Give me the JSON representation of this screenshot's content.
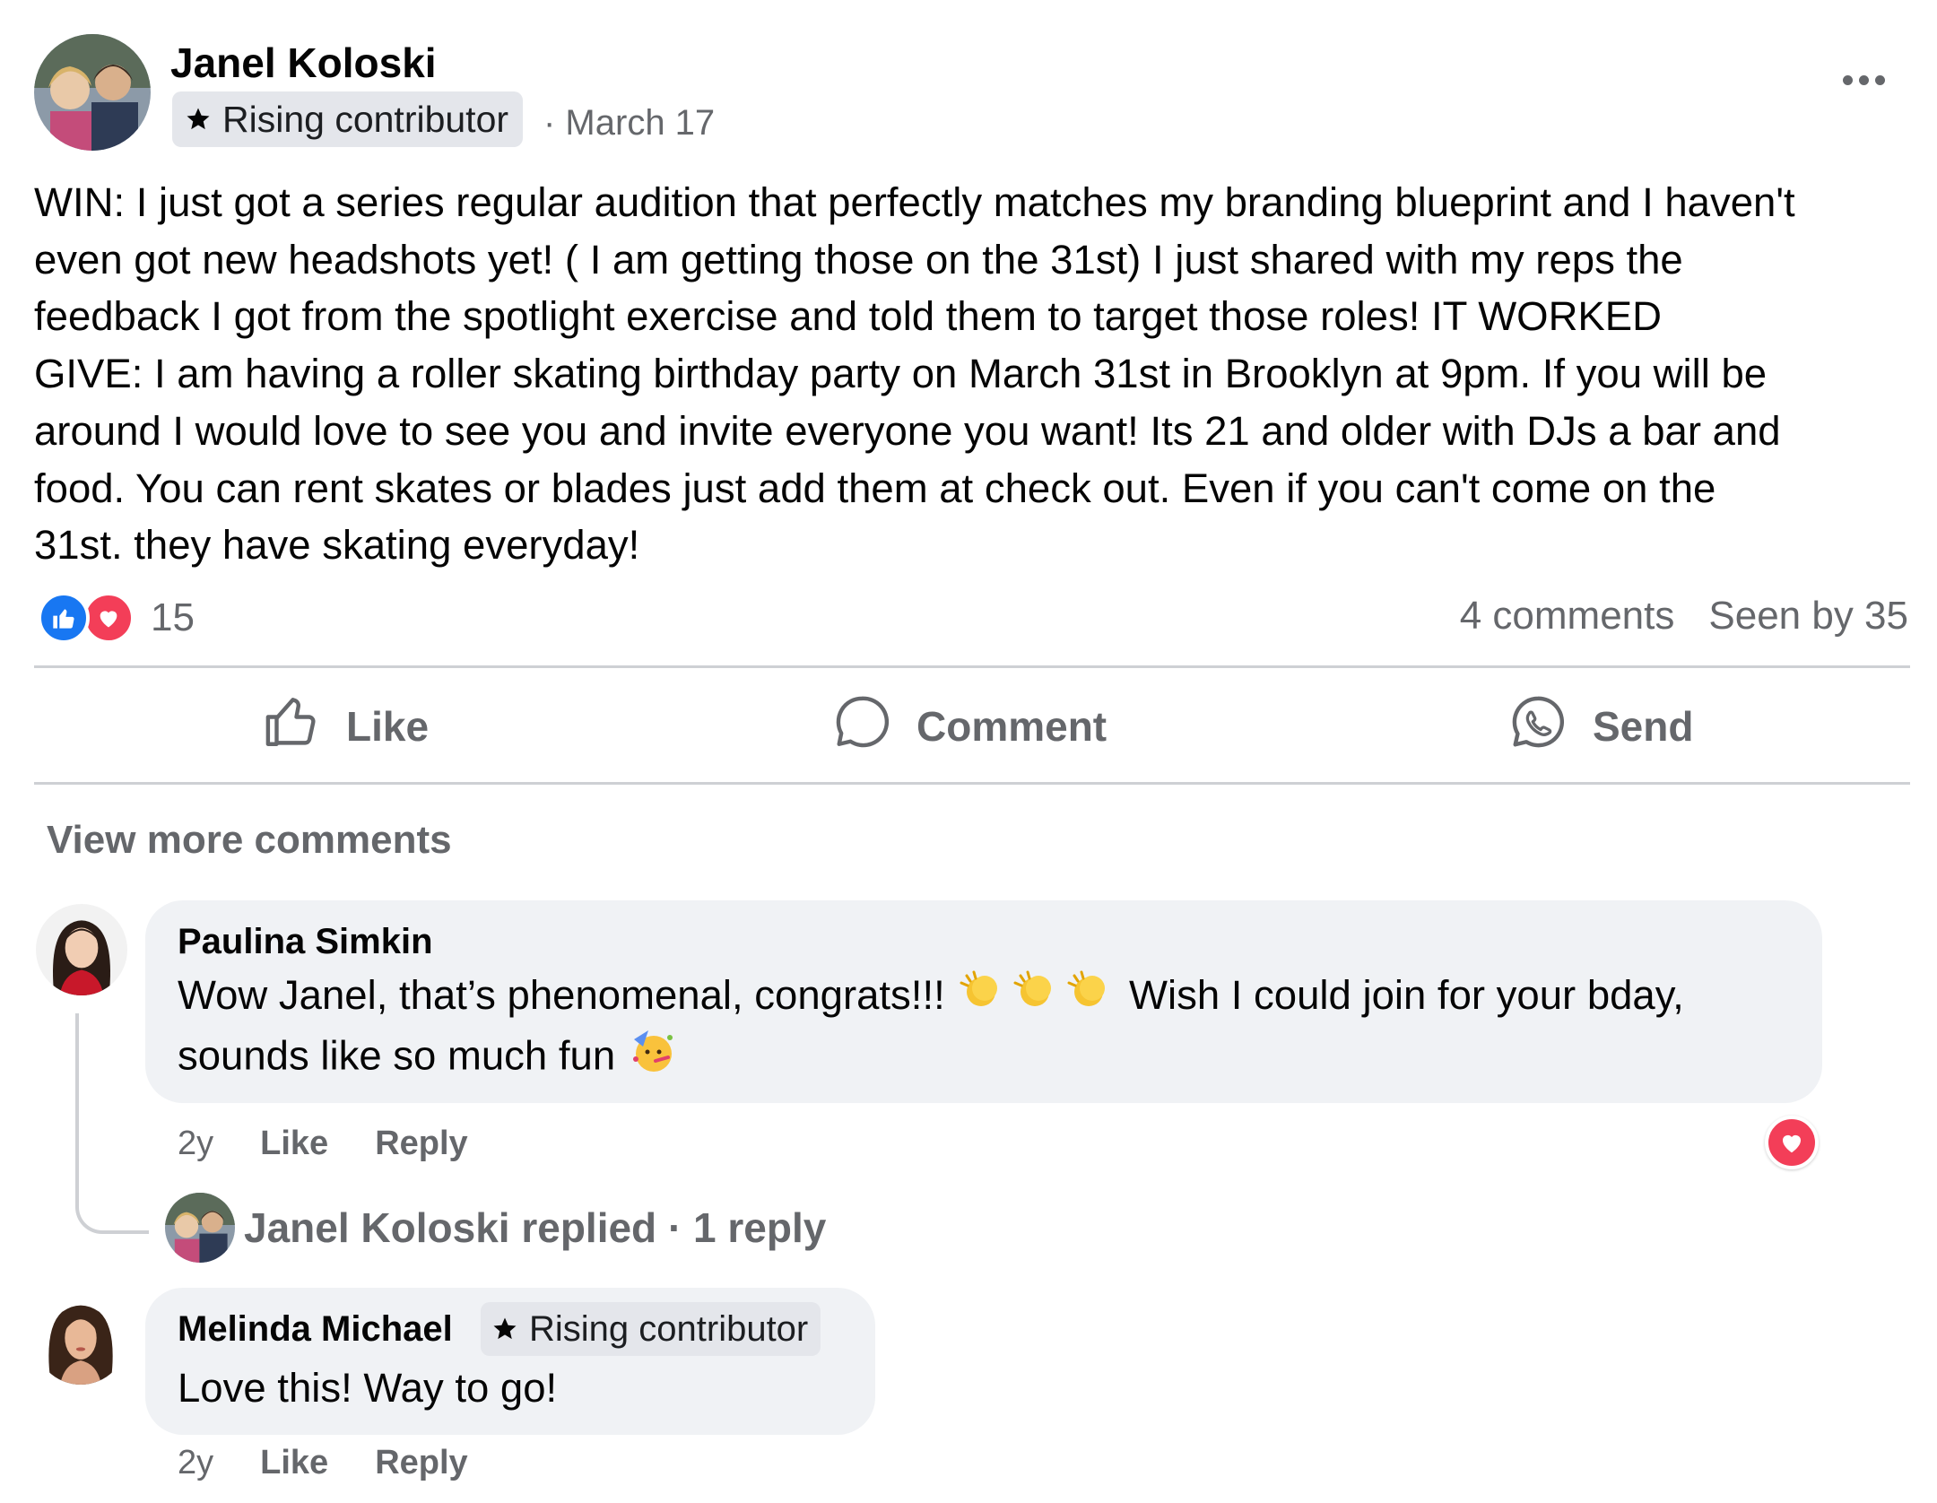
{
  "post": {
    "author": "Janel Koloski",
    "badge": "Rising contributor",
    "meta": "· March 17",
    "body_lines": [
      "WIN: I just got a series regular audition that perfectly matches my branding blueprint and I haven't",
      "even got new headshots yet!  ( I am getting those on the 31st) I just shared with my reps the",
      "feedback I got from the spotlight exercise and told them to target those roles! IT WORKED",
      "GIVE:  I am having a roller skating birthday party on March 31st in Brooklyn at 9pm.  If you will be",
      "around I would love to see you and invite everyone you want!  Its 21 and older with DJs a bar and",
      "food.  You can rent skates or blades just add them at check out.  Even if you can't come on the",
      "31st. they have skating everyday!"
    ],
    "reaction_count": "15",
    "comments_count": "4 comments",
    "seen_by": "Seen by 35"
  },
  "actions": {
    "like": "Like",
    "comment": "Comment",
    "send": "Send"
  },
  "view_more": "View more comments",
  "comments": [
    {
      "name": "Paulina Simkin",
      "text_part1": "Wow Janel, that’s phenomenal, congrats!!! ",
      "text_part2": " Wish I could join for your bday,",
      "text_line2": "sounds like so much fun ",
      "time": "2y",
      "like": "Like",
      "reply": "Reply"
    },
    {
      "name": "Melinda Michael",
      "badge": "Rising contributor",
      "text": "Love this! Way to go!",
      "time": "2y",
      "like": "Like",
      "reply": "Reply"
    }
  ],
  "reply_summary": "Janel Koloski replied · 1 reply",
  "colors": {
    "facebook_blue": "#1877f2",
    "love_red": "#f33e58",
    "secondary_text": "#65676b",
    "bubble_bg": "#f0f2f5"
  },
  "icons": [
    "more-icon",
    "star-icon",
    "like-reaction-icon",
    "love-reaction-icon",
    "thumbs-up-icon",
    "comment-icon",
    "messenger-icon",
    "clapping-hands-icon",
    "partying-face-icon",
    "heart-icon"
  ]
}
